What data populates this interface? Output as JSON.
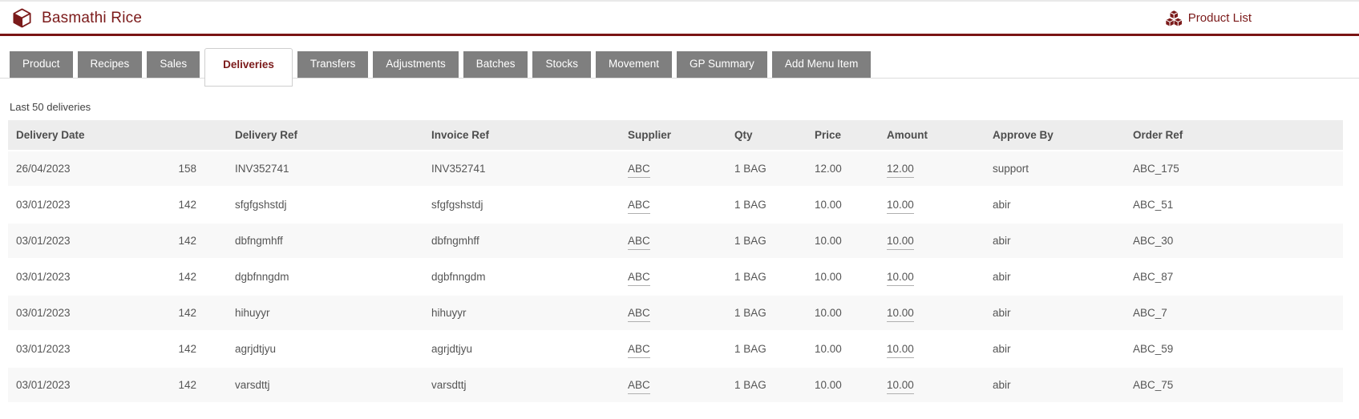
{
  "header": {
    "title": "Basmathi Rice",
    "product_list_label": "Product List"
  },
  "colors": {
    "accent_maroon": "#7b1a1a",
    "rule_maroon": "#7a1414",
    "tab_gray": "#7f7f7f",
    "table_header_bg": "#ededed",
    "row_stripe": "#f8f8f8"
  },
  "icons": {
    "brand": "cube-icon",
    "product_list": "cubes-icon"
  },
  "tabs": [
    {
      "label": "Product",
      "active": false
    },
    {
      "label": "Recipes",
      "active": false
    },
    {
      "label": "Sales",
      "active": false
    },
    {
      "label": "Deliveries",
      "active": true
    },
    {
      "label": "Transfers",
      "active": false
    },
    {
      "label": "Adjustments",
      "active": false
    },
    {
      "label": "Batches",
      "active": false
    },
    {
      "label": "Stocks",
      "active": false
    },
    {
      "label": "Movement",
      "active": false
    },
    {
      "label": "GP Summary",
      "active": false
    },
    {
      "label": "Add Menu Item",
      "active": false
    }
  ],
  "deliveries": {
    "caption": "Last 50 deliveries",
    "columns": [
      "Delivery Date",
      "",
      "Delivery Ref",
      "Invoice Ref",
      "Supplier",
      "Qty",
      "Price",
      "Amount",
      "Approve By",
      "Order Ref"
    ],
    "rows": [
      {
        "date": "26/04/2023",
        "num": "158",
        "delivery_ref": "INV352741",
        "invoice_ref": "INV352741",
        "supplier": "ABC",
        "qty": "1 BAG",
        "price": "12.00",
        "amount": "12.00",
        "approve_by": "support",
        "order_ref": "ABC_175"
      },
      {
        "date": "03/01/2023",
        "num": "142",
        "delivery_ref": "sfgfgshstdj",
        "invoice_ref": "sfgfgshstdj",
        "supplier": "ABC",
        "qty": "1 BAG",
        "price": "10.00",
        "amount": "10.00",
        "approve_by": "abir",
        "order_ref": "ABC_51"
      },
      {
        "date": "03/01/2023",
        "num": "142",
        "delivery_ref": "dbfngmhff",
        "invoice_ref": "dbfngmhff",
        "supplier": "ABC",
        "qty": "1 BAG",
        "price": "10.00",
        "amount": "10.00",
        "approve_by": "abir",
        "order_ref": "ABC_30"
      },
      {
        "date": "03/01/2023",
        "num": "142",
        "delivery_ref": "dgbfnngdm",
        "invoice_ref": "dgbfnngdm",
        "supplier": "ABC",
        "qty": "1 BAG",
        "price": "10.00",
        "amount": "10.00",
        "approve_by": "abir",
        "order_ref": "ABC_87"
      },
      {
        "date": "03/01/2023",
        "num": "142",
        "delivery_ref": "hihuyyr",
        "invoice_ref": "hihuyyr",
        "supplier": "ABC",
        "qty": "1 BAG",
        "price": "10.00",
        "amount": "10.00",
        "approve_by": "abir",
        "order_ref": "ABC_7"
      },
      {
        "date": "03/01/2023",
        "num": "142",
        "delivery_ref": "agrjdtjyu",
        "invoice_ref": "agrjdtjyu",
        "supplier": "ABC",
        "qty": "1 BAG",
        "price": "10.00",
        "amount": "10.00",
        "approve_by": "abir",
        "order_ref": "ABC_59"
      },
      {
        "date": "03/01/2023",
        "num": "142",
        "delivery_ref": "varsdttj",
        "invoice_ref": "varsdttj",
        "supplier": "ABC",
        "qty": "1 BAG",
        "price": "10.00",
        "amount": "10.00",
        "approve_by": "abir",
        "order_ref": "ABC_75"
      }
    ]
  }
}
